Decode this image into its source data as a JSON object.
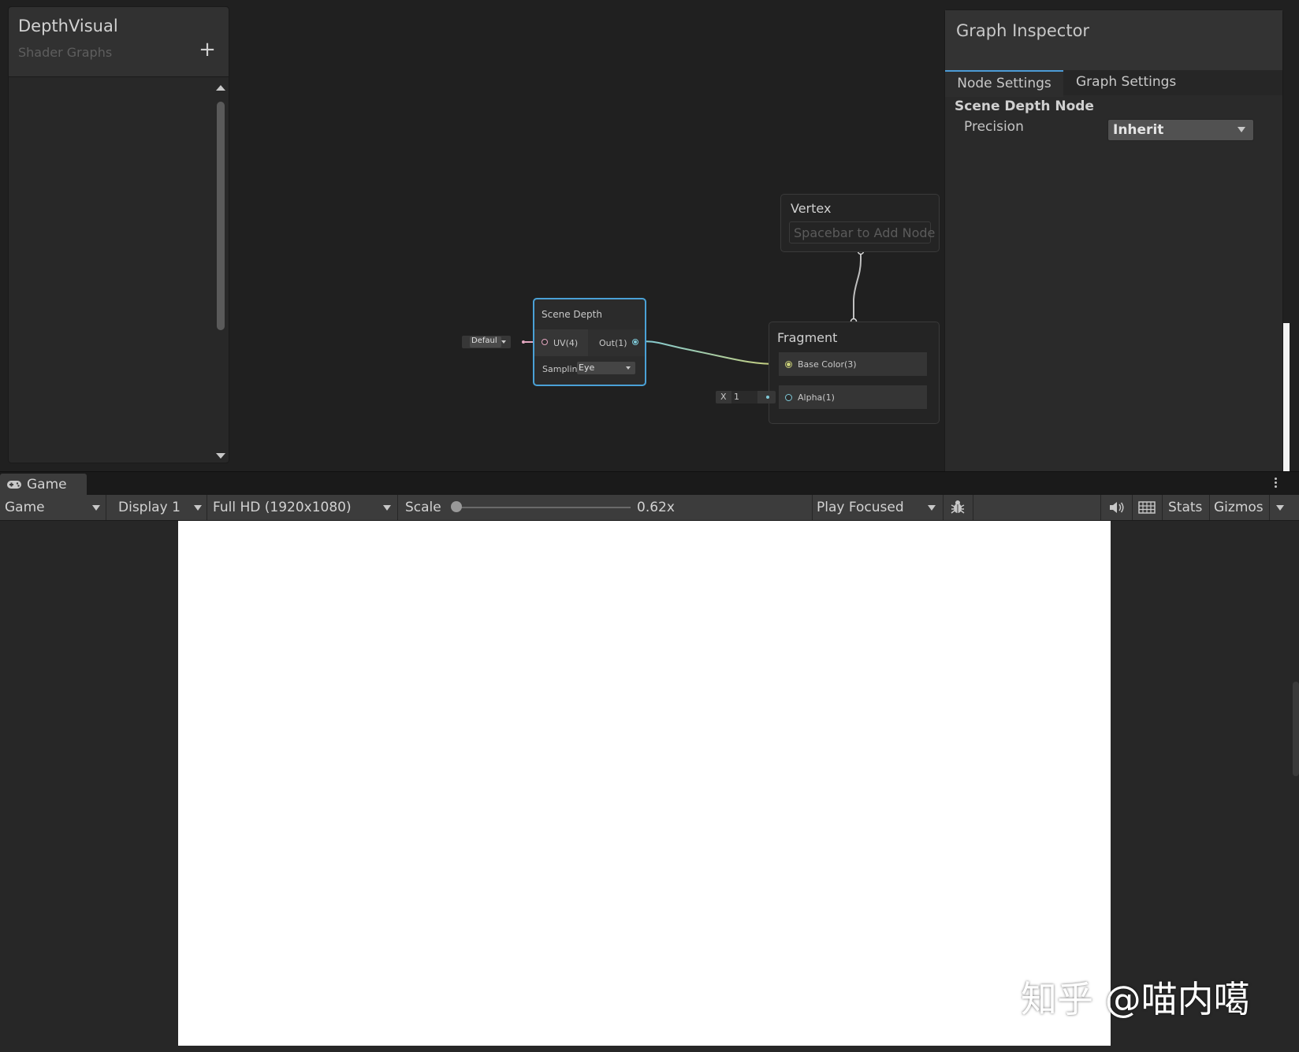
{
  "blackboard": {
    "title": "DepthVisual",
    "subtitle": "Shader Graphs",
    "add_label": "+"
  },
  "inspector": {
    "title": "Graph Inspector",
    "tabs": [
      {
        "label": "Node Settings",
        "active": true
      },
      {
        "label": "Graph Settings",
        "active": false
      }
    ],
    "section_title": "Scene Depth Node",
    "precision_label": "Precision",
    "precision_value": "Inherit"
  },
  "nodes": {
    "vertex": {
      "title": "Vertex",
      "placeholder": "Spacebar to Add Node"
    },
    "fragment": {
      "title": "Fragment",
      "slots": [
        {
          "label": "Base Color(3)"
        },
        {
          "label": "Alpha(1)"
        }
      ],
      "alpha_field_axis": "X",
      "alpha_field_value": "1"
    },
    "scene_depth": {
      "title": "Scene Depth",
      "input_label": "UV(4)",
      "output_label": "Out(1)",
      "sampling_label": "Samplin",
      "sampling_value": "Eye",
      "uv_default_value": "Defaul"
    }
  },
  "game": {
    "tab_label": "Game",
    "toolbar": {
      "view_mode": "Game",
      "display": "Display 1",
      "resolution": "Full HD (1920x1080)",
      "scale_label": "Scale",
      "scale_value": "0.62x",
      "play_mode": "Play Focused",
      "stats": "Stats",
      "gizmos": "Gizmos"
    },
    "icons": {
      "tab_icon": "gamepad-icon",
      "bug_icon": "bug-icon",
      "audio_icon": "speaker-icon",
      "grid_icon": "grid-icon",
      "menu_icon": "kebab-menu-icon"
    }
  },
  "watermark": {
    "text": "知乎 @喵内噶"
  },
  "colors": {
    "accent": "#4aa1d6",
    "uv_port": "#e4a7c0",
    "vector3_port": "#c9cf7a",
    "float_port": "#7fc9d8"
  }
}
